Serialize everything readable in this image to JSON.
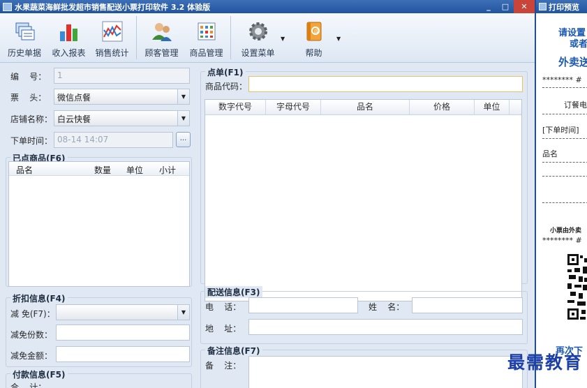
{
  "window": {
    "title": "水果蔬菜海鲜批发超市销售配送小票打印软件 3.2 体验版",
    "minimize": "_",
    "maximize": "□",
    "close": "✕"
  },
  "toolbar": {
    "history": "历史单据",
    "income_report": "收入报表",
    "sales_stats": "销售统计",
    "customer_mgmt": "顾客管理",
    "product_mgmt": "商品管理",
    "settings_menu": "设置菜单",
    "help": "帮助"
  },
  "form": {
    "number_label": "编    号：",
    "number_value": "1",
    "ticket_head_label": "票    头：",
    "ticket_head_value": "微信点餐",
    "store_name_label": "店铺名称：",
    "store_name_value": "白云快餐",
    "order_time_label": "下单时间：",
    "order_time_value": "08-14 14:07",
    "order_time_btn": "..."
  },
  "ordered_items": {
    "title": "已点商品(F6)",
    "columns": [
      "品名",
      "数量",
      "单位",
      "小计"
    ]
  },
  "discount": {
    "title": "折扣信息(F4)",
    "reduce_label": "减 免(F7)：",
    "reduce_value": "",
    "reduce_count_label": "减免份数：",
    "reduce_amount_label": "减免金额："
  },
  "payment": {
    "title": "付款信息(F5)",
    "total_label": "合    计："
  },
  "order": {
    "title": "点单(F1)",
    "product_code_label": "商品代码：",
    "product_code_value": "",
    "columns": [
      "数字代号",
      "字母代号",
      "品名",
      "价格",
      "单位"
    ]
  },
  "delivery": {
    "title": "配送信息(F3)",
    "phone_label": "电    话：",
    "name_label": "姓    名：",
    "address_label": "地    址："
  },
  "notes": {
    "title": "备注信息(F7)",
    "remark_label": "备    注："
  },
  "preview": {
    "title": "打印预览",
    "line1": "请设置",
    "line2": "或者",
    "line3": "外卖送",
    "stars1": "******** #",
    "order_phone": "订餐电",
    "order_time": "[下单时间]",
    "item_name": "品名",
    "promo": "小票由外卖",
    "stars2": "******** #",
    "again": "再次下"
  },
  "watermark": "最需教育"
}
